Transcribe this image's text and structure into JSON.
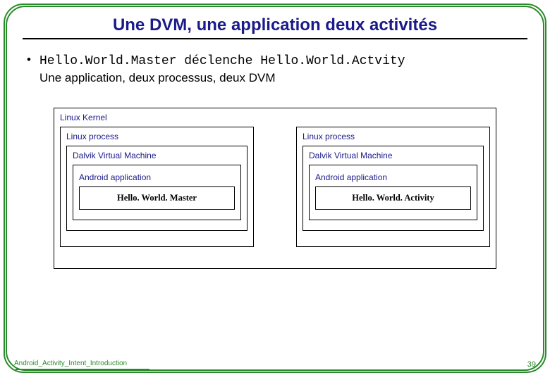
{
  "title": "Une DVM, une application deux activités",
  "bullet": {
    "code1": "Hello.World.Master",
    "mid": " déclenche ",
    "code2": "Hello.World.Actvity",
    "line2": "Une application, deux processus, deux DVM"
  },
  "labels": {
    "kernel": "Linux Kernel",
    "process": "Linux process",
    "dvm": "Dalvik Virtual Machine",
    "app": "Android application"
  },
  "activity": {
    "left": "Hello. World. Master",
    "right": "Hello. World. Activity"
  },
  "footer": {
    "ref": "Android_Activity_Intent_Introduction",
    "page": "39"
  }
}
